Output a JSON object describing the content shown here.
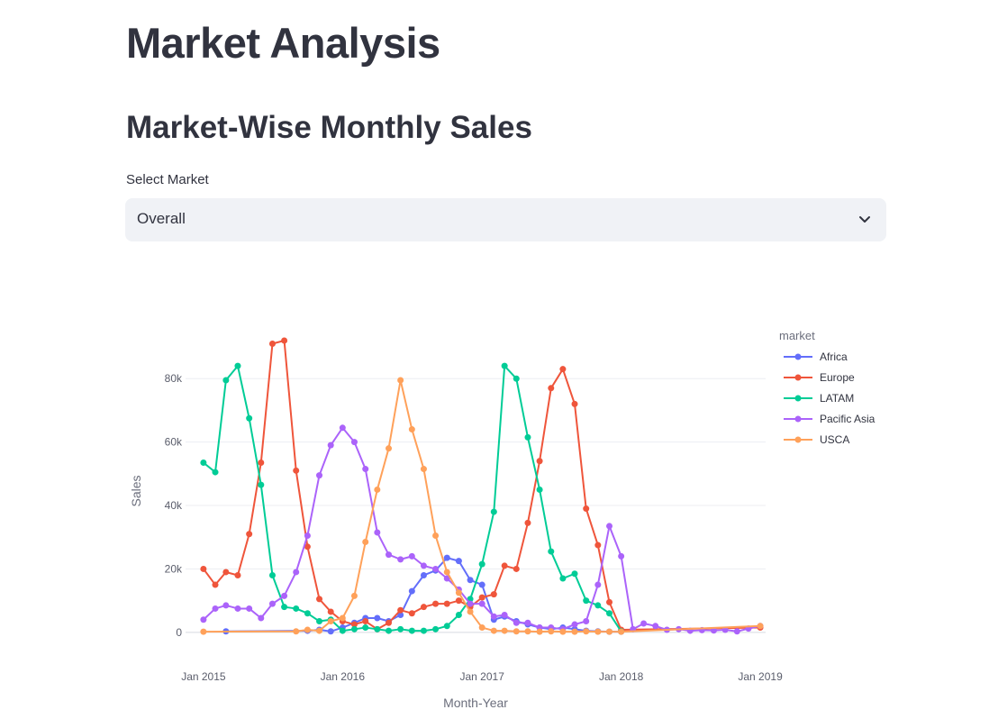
{
  "page": {
    "title": "Market Analysis",
    "section_title": "Market-Wise Monthly Sales"
  },
  "select": {
    "label": "Select Market",
    "value": "Overall",
    "icon": "chevron-down-icon"
  },
  "chart_data": {
    "type": "line",
    "xlabel": "Month-Year",
    "ylabel": "Sales",
    "legend_title": "market",
    "legend_position": "top-right",
    "grid": true,
    "markers": true,
    "x_range": [
      "2014-11-15",
      "2019-01-15"
    ],
    "y_range": [
      -8000,
      92000
    ],
    "x_ticks": [
      {
        "label": "Jan 2015",
        "date": "2015-01-01"
      },
      {
        "label": "Jan 2016",
        "date": "2016-01-01"
      },
      {
        "label": "Jan 2017",
        "date": "2017-01-01"
      },
      {
        "label": "Jan 2018",
        "date": "2018-01-01"
      },
      {
        "label": "Jan 2019",
        "date": "2019-01-01"
      }
    ],
    "y_ticks": [
      {
        "label": "0",
        "value": 0
      },
      {
        "label": "20k",
        "value": 20000
      },
      {
        "label": "40k",
        "value": 40000
      },
      {
        "label": "60k",
        "value": 60000
      },
      {
        "label": "80k",
        "value": 80000
      }
    ],
    "series": [
      {
        "name": "Africa",
        "color": "#636efa",
        "x": [
          "2015-03",
          "2015-10",
          "2015-11",
          "2015-12",
          "2016-01",
          "2016-02",
          "2016-03",
          "2016-04",
          "2016-05",
          "2016-06",
          "2016-07",
          "2016-08",
          "2016-09",
          "2016-10",
          "2016-11",
          "2016-12",
          "2017-01",
          "2017-02",
          "2017-03",
          "2017-04",
          "2017-05",
          "2017-06",
          "2017-07",
          "2017-08",
          "2017-09",
          "2017-10",
          "2017-11",
          "2017-12",
          "2018-01"
        ],
        "y": [
          300,
          500,
          800,
          300,
          1500,
          3000,
          4500,
          4500,
          3500,
          5500,
          13000,
          18000,
          19500,
          23500,
          22500,
          16500,
          15000,
          4000,
          5000,
          3500,
          2500,
          1500,
          1000,
          1500,
          1000,
          500,
          300,
          200,
          200
        ]
      },
      {
        "name": "Europe",
        "color": "#ef553b",
        "x": [
          "2015-01",
          "2015-02",
          "2015-03",
          "2015-04",
          "2015-05",
          "2015-06",
          "2015-07",
          "2015-08",
          "2015-09",
          "2015-10",
          "2015-11",
          "2015-12",
          "2016-01",
          "2016-02",
          "2016-03",
          "2016-04",
          "2016-05",
          "2016-06",
          "2016-07",
          "2016-08",
          "2016-09",
          "2016-10",
          "2016-11",
          "2016-12",
          "2017-01",
          "2017-02",
          "2017-03",
          "2017-04",
          "2017-05",
          "2017-06",
          "2017-07",
          "2017-08",
          "2017-09",
          "2017-10",
          "2017-11",
          "2017-12",
          "2018-01",
          "2019-01"
        ],
        "y": [
          20000,
          15000,
          19000,
          18000,
          31000,
          53500,
          91000,
          92000,
          51000,
          27000,
          10500,
          6500,
          3500,
          2500,
          3500,
          1000,
          3000,
          7000,
          6000,
          8000,
          9000,
          9000,
          10000,
          8000,
          11000,
          12000,
          21000,
          20000,
          34500,
          54000,
          77000,
          83000,
          72000,
          39000,
          27500,
          9500,
          800,
          1500
        ]
      },
      {
        "name": "LATAM",
        "color": "#00cc96",
        "x": [
          "2015-01",
          "2015-02",
          "2015-03",
          "2015-04",
          "2015-05",
          "2015-06",
          "2015-07",
          "2015-08",
          "2015-09",
          "2015-10",
          "2015-11",
          "2015-12",
          "2016-01",
          "2016-02",
          "2016-03",
          "2016-04",
          "2016-05",
          "2016-06",
          "2016-07",
          "2016-08",
          "2016-09",
          "2016-10",
          "2016-11",
          "2016-12",
          "2017-01",
          "2017-02",
          "2017-03",
          "2017-04",
          "2017-05",
          "2017-06",
          "2017-07",
          "2017-08",
          "2017-09",
          "2017-10",
          "2017-11",
          "2017-12",
          "2018-01"
        ],
        "y": [
          53500,
          50500,
          79500,
          84000,
          67500,
          46500,
          18000,
          8000,
          7500,
          6000,
          3500,
          4000,
          500,
          1000,
          1500,
          1000,
          500,
          1000,
          500,
          500,
          1000,
          2000,
          5500,
          10500,
          21500,
          38000,
          84000,
          80000,
          61500,
          45000,
          25500,
          17000,
          18500,
          10000,
          8500,
          6000,
          300
        ]
      },
      {
        "name": "Pacific Asia",
        "color": "#ab63fa",
        "x": [
          "2015-01",
          "2015-02",
          "2015-03",
          "2015-04",
          "2015-05",
          "2015-06",
          "2015-07",
          "2015-08",
          "2015-09",
          "2015-10",
          "2015-11",
          "2015-12",
          "2016-01",
          "2016-02",
          "2016-03",
          "2016-04",
          "2016-05",
          "2016-06",
          "2016-07",
          "2016-08",
          "2016-09",
          "2016-10",
          "2016-11",
          "2016-12",
          "2017-01",
          "2017-02",
          "2017-03",
          "2017-04",
          "2017-05",
          "2017-06",
          "2017-07",
          "2017-08",
          "2017-09",
          "2017-10",
          "2017-11",
          "2017-12",
          "2018-01",
          "2018-02",
          "2018-03",
          "2018-04",
          "2018-05",
          "2018-06",
          "2018-07",
          "2018-08",
          "2018-09",
          "2018-10",
          "2018-11",
          "2018-12",
          "2019-01"
        ],
        "y": [
          4000,
          7500,
          8500,
          7500,
          7500,
          4500,
          9000,
          11500,
          19000,
          30500,
          49500,
          59000,
          64500,
          60000,
          51500,
          31500,
          24500,
          23000,
          24000,
          21000,
          20000,
          17000,
          13500,
          9000,
          9000,
          5000,
          5500,
          3000,
          3000,
          1500,
          1500,
          1000,
          2500,
          3500,
          15000,
          33500,
          24000,
          1000,
          2800,
          2000,
          800,
          1000,
          500,
          700,
          600,
          800,
          300,
          1200,
          2000
        ]
      },
      {
        "name": "USCA",
        "color": "#ffa15a",
        "x": [
          "2015-01",
          "2015-09",
          "2015-10",
          "2015-11",
          "2015-12",
          "2016-01",
          "2016-02",
          "2016-03",
          "2016-04",
          "2016-05",
          "2016-06",
          "2016-07",
          "2016-08",
          "2016-09",
          "2016-10",
          "2016-11",
          "2016-12",
          "2017-01",
          "2017-02",
          "2017-03",
          "2017-04",
          "2017-05",
          "2017-06",
          "2017-07",
          "2017-08",
          "2017-09",
          "2017-10",
          "2017-11",
          "2017-12",
          "2018-01",
          "2019-01"
        ],
        "y": [
          200,
          300,
          800,
          500,
          3500,
          4500,
          11500,
          28500,
          45000,
          58000,
          79500,
          64000,
          51500,
          30500,
          19000,
          12500,
          6500,
          1500,
          500,
          500,
          300,
          300,
          200,
          300,
          200,
          200,
          300,
          200,
          200,
          200,
          2000
        ]
      }
    ]
  }
}
